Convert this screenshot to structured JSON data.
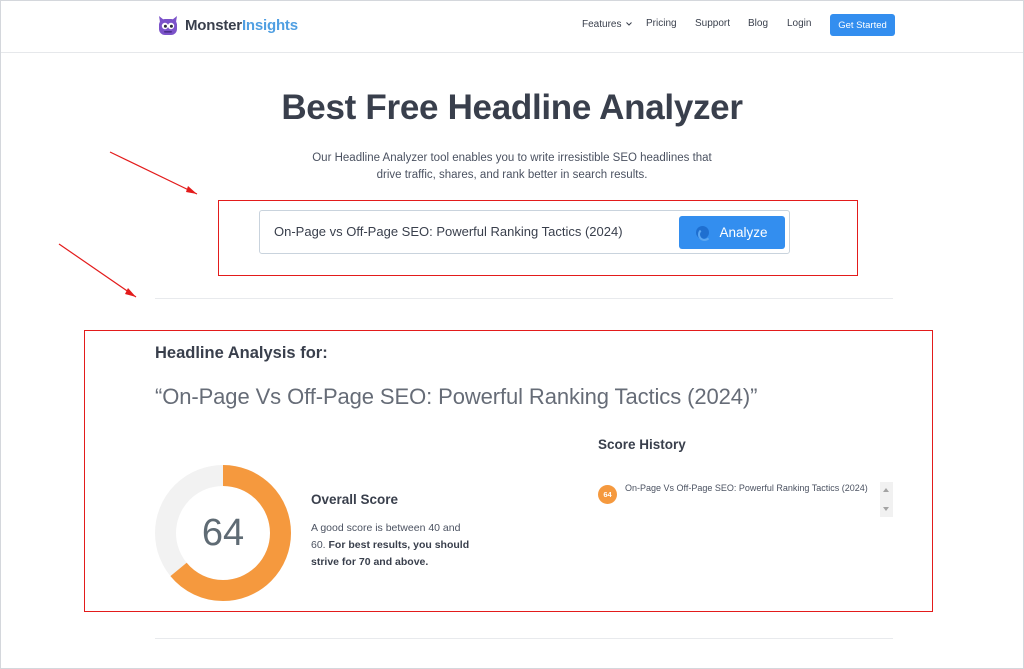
{
  "header": {
    "brand": {
      "part1": "Monster",
      "part2": "Insights"
    },
    "nav": {
      "features": "Features",
      "pricing": "Pricing",
      "support": "Support",
      "blog": "Blog",
      "login": "Login"
    },
    "cta_label": "Get Started"
  },
  "hero": {
    "title": "Best Free Headline Analyzer",
    "description": "Our Headline Analyzer tool enables you to write irresistible SEO headlines that drive traffic, shares, and rank better in search results.",
    "input_value": "On-Page vs Off-Page SEO: Powerful Ranking Tactics (2024)",
    "analyze_label": "Analyze"
  },
  "results": {
    "heading": "Headline Analysis for:",
    "headline_quoted": "“On-Page Vs Off-Page SEO: Powerful Ranking Tactics (2024)”",
    "overall": {
      "score": "64",
      "score_value": 64,
      "title": "Overall Score",
      "desc_plain": "A good score is between 40 and 60. ",
      "desc_bold": "For best results, you should strive for 70 and above."
    },
    "history": {
      "title": "Score History",
      "items": [
        {
          "score": "64",
          "headline": "On-Page Vs Off-Page SEO: Powerful Ranking Tactics (2024)"
        }
      ]
    }
  },
  "colors": {
    "accent_blue": "#338eef",
    "score_orange": "#f5993e",
    "donut_track": "#f2f2f2",
    "annotation_red": "#e31b1b"
  }
}
